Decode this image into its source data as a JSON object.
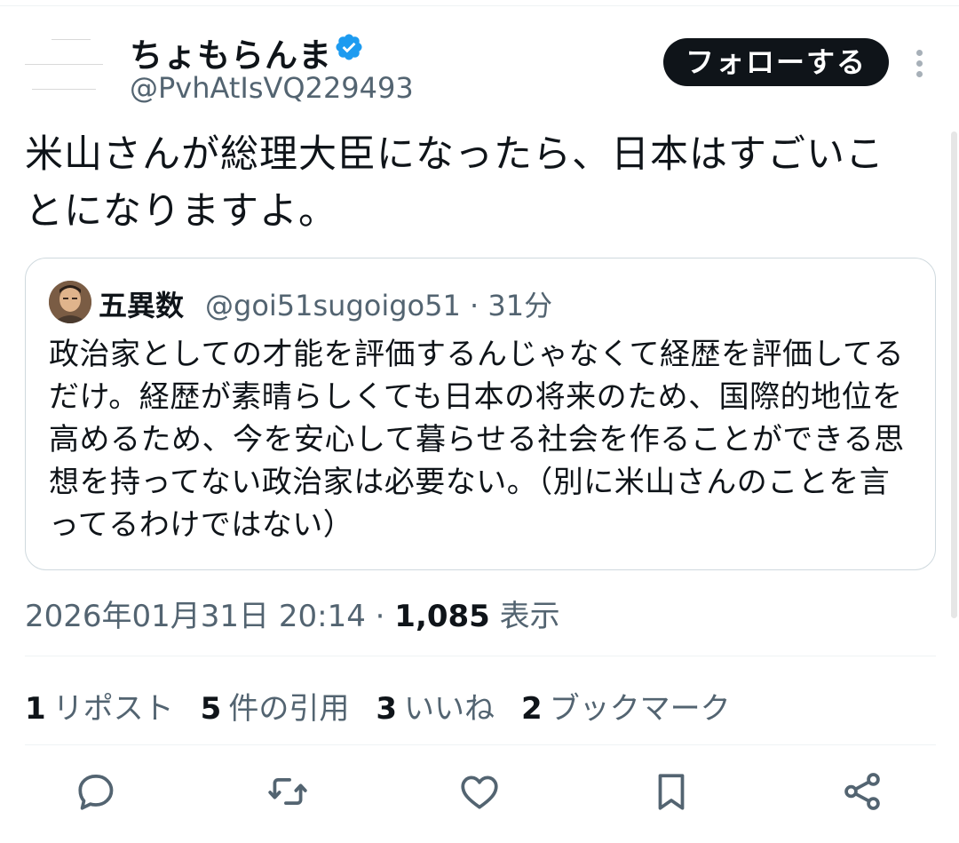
{
  "author": {
    "display_name": "ちょもらんま",
    "handle": "@PvhAtIsVQ229493",
    "verified": true
  },
  "follow_button": {
    "label": "フォローする"
  },
  "tweet": {
    "text": "米山さんが総理大臣になったら、日本はすごいことになりますよ。"
  },
  "quote": {
    "display_name": "五異数",
    "meta": "@goi51sugoigo51 · 31分",
    "text": "政治家としての才能を評価するんじゃなくて経歴を評価してるだけ。経歴が素晴らしくても日本の将来のため、国際的地位を高めるため、今を安心して暮らせる社会を作ることができる思想を持ってない政治家は必要ない。（別に米山さんのことを言ってるわけではない）"
  },
  "timestamp": {
    "datetime": "2026年01月31日 20:14",
    "separator": " · ",
    "views_count": "1,085",
    "views_label": " 表示"
  },
  "stats": [
    {
      "num": "1",
      "label": "リポスト"
    },
    {
      "num": "5",
      "label": "件の引用"
    },
    {
      "num": "3",
      "label": "いいね"
    },
    {
      "num": "2",
      "label": "ブックマーク"
    }
  ],
  "actions": [
    {
      "icon": "reply-icon"
    },
    {
      "icon": "retweet-icon"
    },
    {
      "icon": "like-icon"
    },
    {
      "icon": "bookmark-icon"
    },
    {
      "icon": "share-icon"
    }
  ],
  "colors": {
    "text_primary": "#0f1419",
    "text_secondary": "#536471",
    "verified_blue": "#1d9bf0",
    "border": "#cfd9de",
    "icon": "#536471"
  }
}
